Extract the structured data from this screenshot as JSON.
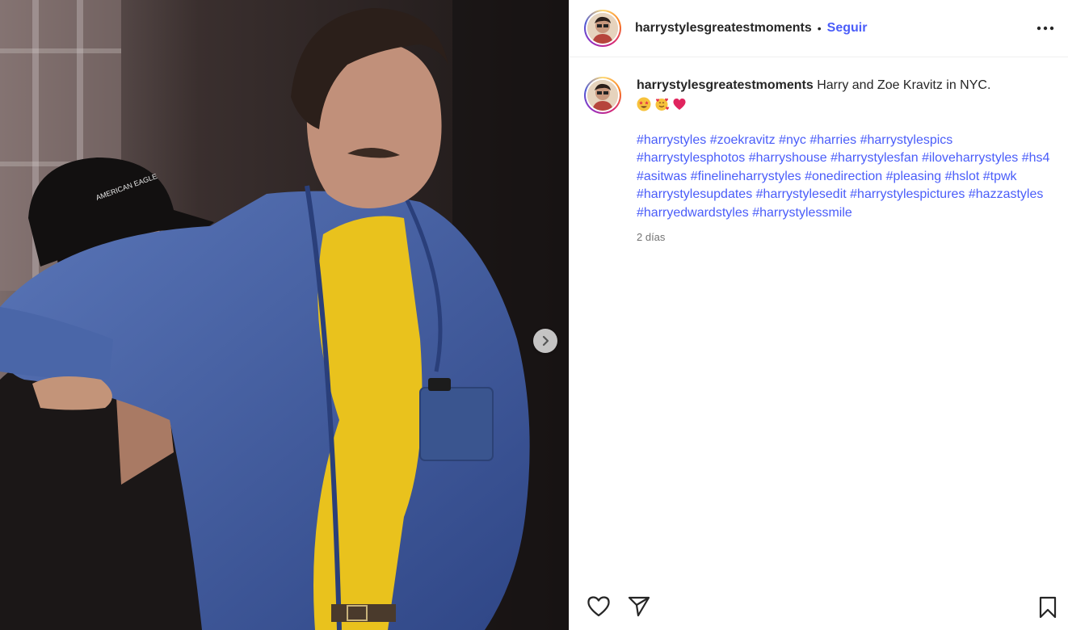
{
  "post": {
    "username": "harrystylesgreatestmoments",
    "separator": "•",
    "follow_label": "Seguir",
    "caption_text": "Harry and Zoe Kravitz in NYC.",
    "hashtags": [
      "#harrystyles",
      "#zoekravitz",
      "#nyc",
      "#harries",
      "#harrystylespics",
      "#harrystylesphotos",
      "#harryshouse",
      "#harrystylesfan",
      "#iloveharrystyles",
      "#hs4",
      "#asitwas",
      "#finelineharrystyles",
      "#onedirection",
      "#pleasing",
      "#hslot",
      "#tpwk",
      "#harrystylesupdates",
      "#harrystylesedit",
      "#harrystylespictures",
      "#hazzastyles",
      "#harryedwardstyles",
      "#harrystylessmile"
    ],
    "timestamp": "2 días",
    "cap_text": "AMERICAN EAGLE"
  },
  "icons": {
    "more": "more-options-icon",
    "next": "chevron-right-icon",
    "like": "heart-outline-icon",
    "share": "paper-plane-icon",
    "save": "bookmark-outline-icon",
    "emojis": [
      "star-struck-emoji",
      "smiling-face-with-hearts-emoji",
      "red-heart-emoji"
    ]
  },
  "colors": {
    "link": "#4a5df9",
    "text": "#262626",
    "muted": "#737373",
    "jacket": "#3f5a9c",
    "shirt": "#e9c21d"
  }
}
